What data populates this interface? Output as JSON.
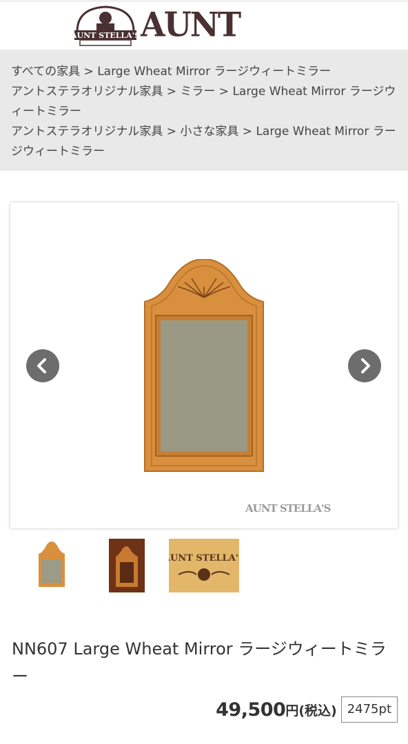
{
  "header": {
    "logo_text": "AUNT STELLA'S",
    "badge_text": "AUNT STELLA'S"
  },
  "breadcrumbs": [
    {
      "parts": [
        "すべての家具",
        "Large Wheat Mirror ラージウィートミラー"
      ]
    },
    {
      "parts": [
        "アントステラオリジナル家具",
        "ミラー",
        "Large Wheat Mirror ラージウィートミラー"
      ]
    },
    {
      "parts": [
        "アントステラオリジナル家具",
        "小さな家具",
        "Large Wheat Mirror ラージウィートミラー"
      ]
    }
  ],
  "breadcrumb_separator": " > ",
  "gallery": {
    "watermark": "AUNT STELLA'S",
    "thumbnail_count": 3
  },
  "thumb3_text": "AUNT STELLA'S",
  "product": {
    "title": "NN607 Large Wheat Mirror ラージウィートミラー",
    "price": "49,500",
    "price_suffix": "円(税込)",
    "points": "2475pt"
  },
  "colors": {
    "breadcrumb_bg": "#e9e9e9",
    "logo_color": "#4a3030",
    "arrow_bg": "#6d6d6d",
    "wood": "#d98c3a"
  }
}
